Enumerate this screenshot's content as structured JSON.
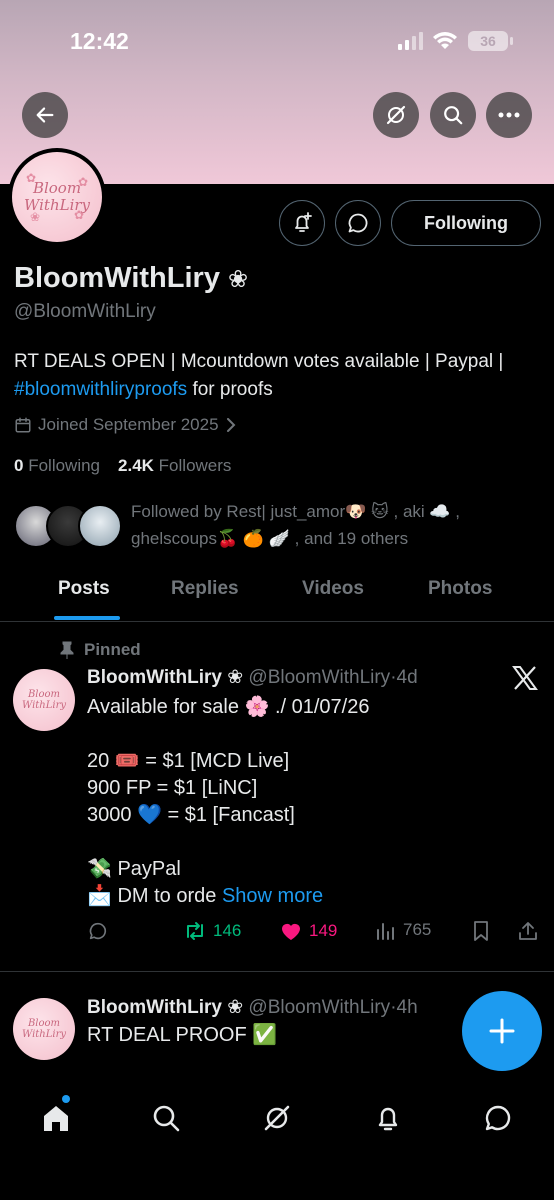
{
  "status_bar": {
    "time": "12:42",
    "battery": "36"
  },
  "profile": {
    "avatar_text_line1": "Bloom",
    "avatar_text_line2": "WithLiry",
    "name": "BloomWithLiry",
    "name_symbol": "❀",
    "handle": "@BloomWithLiry",
    "bio_text": "RT DEALS OPEN | Mcountdown votes available | Paypal |",
    "bio_hashtag": "#bloomwithliryproofs",
    "bio_suffix": " for proofs",
    "joined": "Joined September 2025",
    "following_count": "0",
    "following_label": "Following",
    "followers_count": "2.4K",
    "followers_label": "Followers",
    "followed_by": "Followed by Rest| just_amor🐶 🐱 , aki ☁️ , ghelscoups🍒 🍊 🪽 , and 19 others"
  },
  "buttons": {
    "following": "Following"
  },
  "tabs": [
    {
      "label": "Posts",
      "active": true
    },
    {
      "label": "Replies",
      "active": false
    },
    {
      "label": "Videos",
      "active": false
    },
    {
      "label": "Photos",
      "active": false
    }
  ],
  "posts": [
    {
      "pinned_label": "Pinned",
      "name": "BloomWithLiry ❀",
      "handle": "@BloomWithLiry",
      "time": "·4d",
      "text": "Available for sale 🌸 ./ 01/07/26\n\n20 🎟️ = $1 [MCD Live]\n900 FP = $1 [LiNC]\n3000 💙 = $1 [Fancast]\n\n💸 PayPal\n📩 DM to orde",
      "show_more": "Show more",
      "retweets": "146",
      "likes": "149",
      "views": "765"
    },
    {
      "name": "BloomWithLiry ❀",
      "handle": "@BloomWithLiry",
      "time": "·4h",
      "text": "RT DEAL PROOF ✅"
    }
  ],
  "colors": {
    "accent": "#1d9bf0",
    "like": "#f91880",
    "retweet": "#00ba7c",
    "muted": "#71767b"
  }
}
